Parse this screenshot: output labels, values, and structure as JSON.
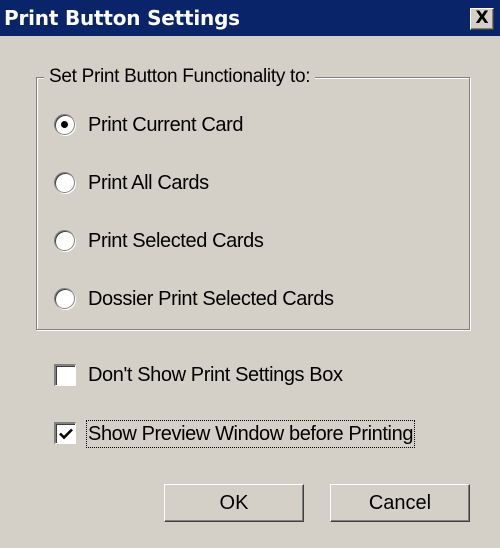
{
  "window": {
    "title": "Print Button Settings",
    "close_label": "X",
    "colors": {
      "title_bar": "#0a246a",
      "face": "#d4d0c8"
    }
  },
  "group": {
    "legend": "Set Print Button Functionality to:",
    "options": [
      {
        "label": "Print Current Card",
        "selected": true
      },
      {
        "label": "Print All Cards",
        "selected": false
      },
      {
        "label": "Print Selected Cards",
        "selected": false
      },
      {
        "label": "Dossier Print Selected Cards",
        "selected": false
      }
    ]
  },
  "checkboxes": [
    {
      "label": "Don't Show Print Settings Box",
      "checked": false
    },
    {
      "label": "Show Preview Window before Printing",
      "checked": true
    }
  ],
  "buttons": {
    "ok": "OK",
    "cancel": "Cancel"
  }
}
